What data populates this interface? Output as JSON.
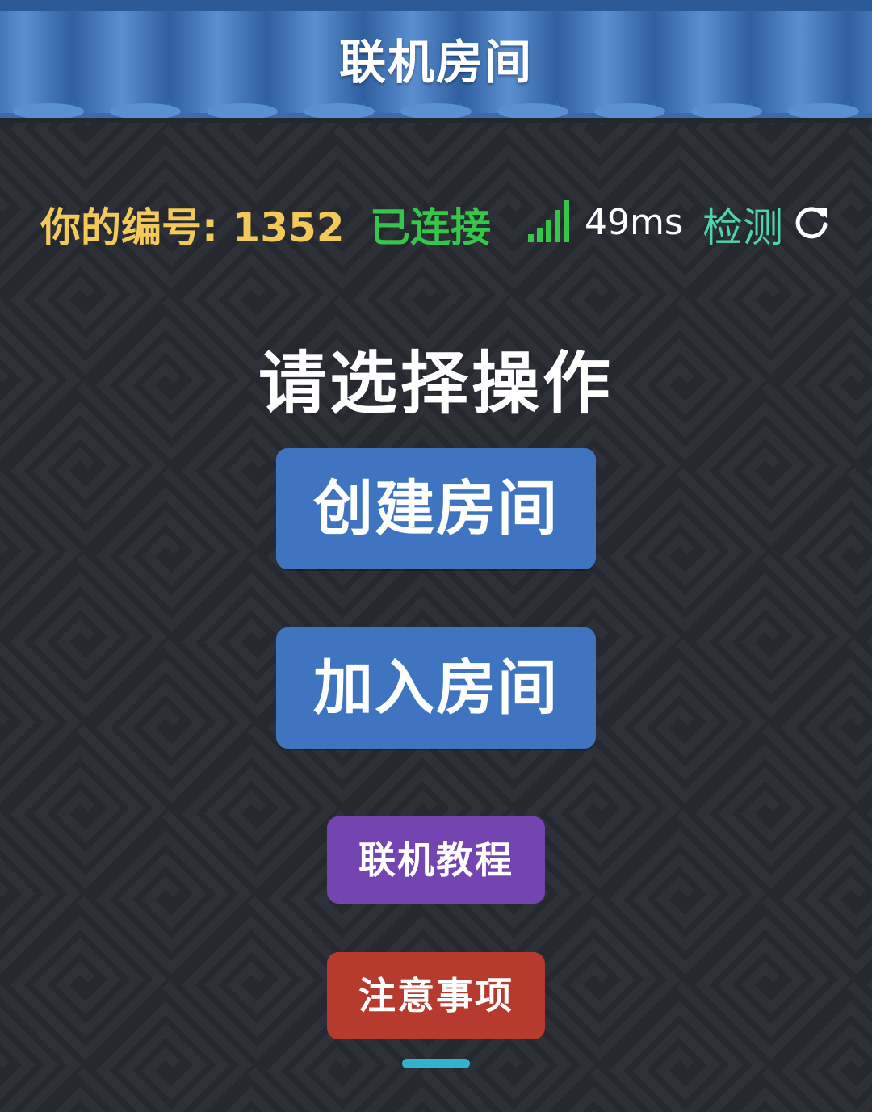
{
  "header": {
    "title": "联机房间"
  },
  "status": {
    "player_id_label": "你的编号:",
    "player_id": "1352",
    "connection": "已连接",
    "signal_bars": 5,
    "ping": "49ms",
    "detect_label": "检测"
  },
  "main": {
    "prompt": "请选择操作",
    "create_room": "创建房间",
    "join_room": "加入房间",
    "tutorial": "联机教程",
    "notes": "注意事项"
  },
  "colors": {
    "header_blue": "#3f74b8",
    "background": "#25282e",
    "player_id_yellow": "#f3c95a",
    "connected_green": "#35c64a",
    "detect_teal": "#4fd6a8",
    "button_blue": "#3f74c0",
    "tutorial_purple": "#7444b0",
    "notes_red": "#b63a2e",
    "home_indicator": "#31b3d0"
  },
  "icons": {
    "signal": "signal-bars-icon",
    "refresh": "refresh-icon"
  }
}
